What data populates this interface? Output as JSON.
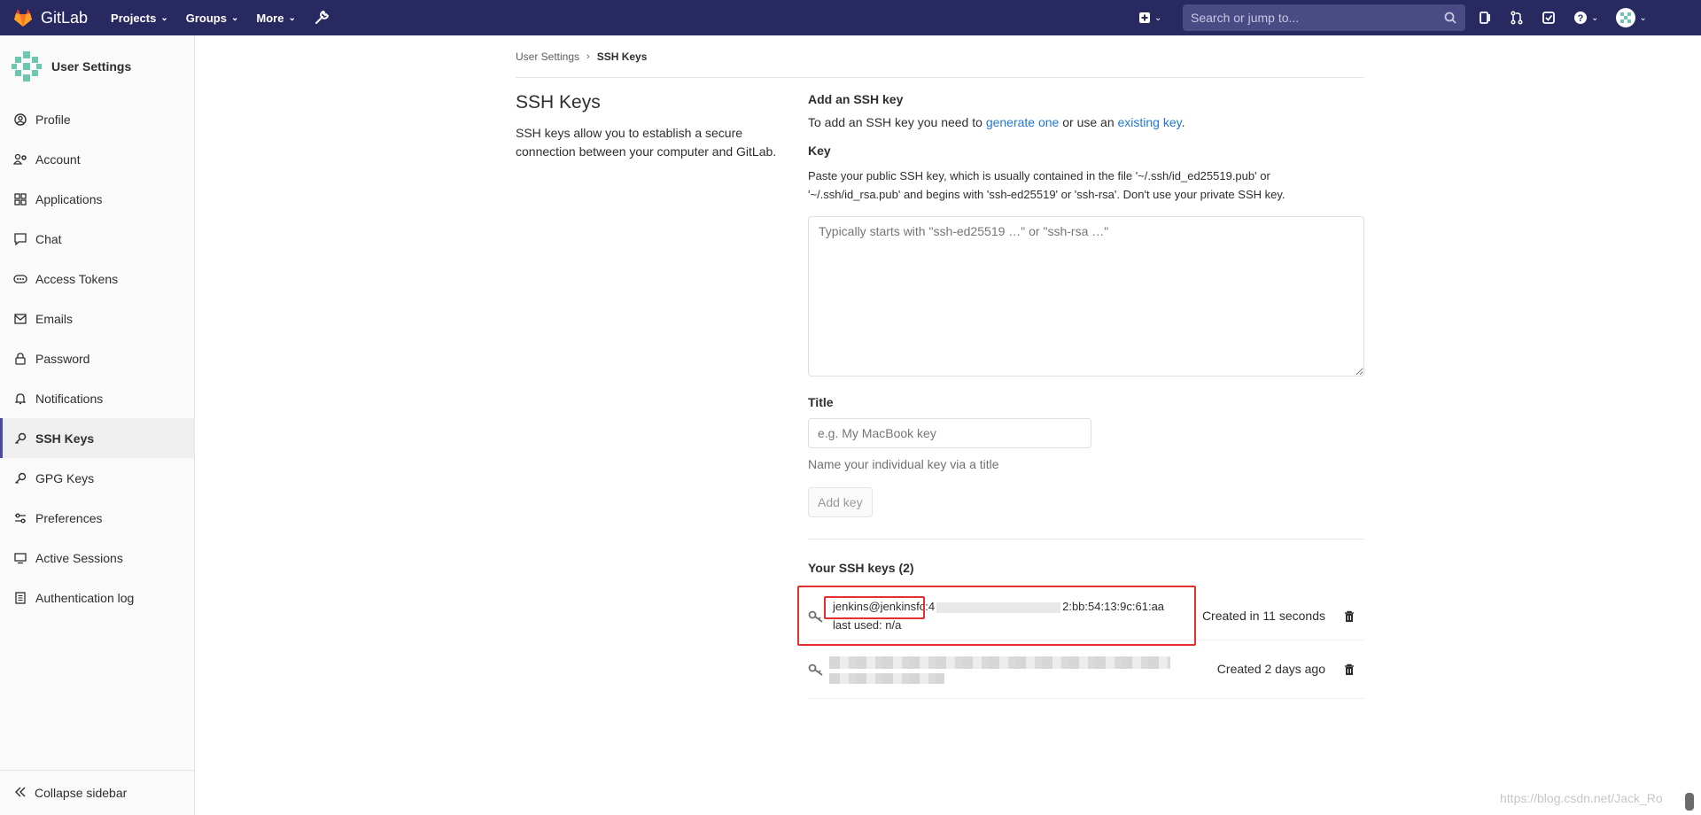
{
  "navbar": {
    "brand": "GitLab",
    "menu": [
      {
        "label": "Projects",
        "icon": "chevron-down-icon"
      },
      {
        "label": "Groups",
        "icon": "chevron-down-icon"
      },
      {
        "label": "More",
        "icon": "chevron-down-icon"
      }
    ],
    "search_placeholder": "Search or jump to..."
  },
  "sidebar": {
    "title": "User Settings",
    "items": [
      {
        "label": "Profile",
        "icon": "profile-icon"
      },
      {
        "label": "Account",
        "icon": "account-icon"
      },
      {
        "label": "Applications",
        "icon": "applications-icon"
      },
      {
        "label": "Chat",
        "icon": "chat-icon"
      },
      {
        "label": "Access Tokens",
        "icon": "token-icon"
      },
      {
        "label": "Emails",
        "icon": "mail-icon"
      },
      {
        "label": "Password",
        "icon": "lock-icon"
      },
      {
        "label": "Notifications",
        "icon": "bell-icon"
      },
      {
        "label": "SSH Keys",
        "icon": "key-icon",
        "active": true
      },
      {
        "label": "GPG Keys",
        "icon": "key-icon"
      },
      {
        "label": "Preferences",
        "icon": "preferences-icon"
      },
      {
        "label": "Active Sessions",
        "icon": "monitor-icon"
      },
      {
        "label": "Authentication log",
        "icon": "log-icon"
      }
    ],
    "collapse_label": "Collapse sidebar"
  },
  "breadcrumb": {
    "parent": "User Settings",
    "current": "SSH Keys"
  },
  "intro": {
    "title": "SSH Keys",
    "description": "SSH keys allow you to establish a secure connection between your computer and GitLab."
  },
  "add_key": {
    "heading": "Add an SSH key",
    "text_before": "To add an SSH key you need to ",
    "generate_link": "generate one",
    "text_middle": " or use an ",
    "existing_link": "existing key",
    "text_after": ".",
    "key_label": "Key",
    "key_hint": "Paste your public SSH key, which is usually contained in the file '~/.ssh/id_ed25519.pub' or '~/.ssh/id_rsa.pub' and begins with 'ssh-ed25519' or 'ssh-rsa'. Don't use your private SSH key.",
    "key_placeholder": "Typically starts with \"ssh-ed25519 …\" or \"ssh-rsa …\"",
    "title_label": "Title",
    "title_placeholder": "e.g. My MacBook key",
    "title_help": "Name your individual key via a title",
    "add_button": "Add key"
  },
  "keys": {
    "heading": "Your SSH keys (2)",
    "list": [
      {
        "title": "jenkins@jenkins",
        "fingerprint_start": "fc:4",
        "fingerprint_end": "2:bb:54:13:9c:61:aa",
        "last_used": "last used: n/a",
        "created": "Created in 11 seconds"
      },
      {
        "created": "Created 2 days ago"
      }
    ]
  },
  "watermark": "https://blog.csdn.net/Jack_Ro"
}
